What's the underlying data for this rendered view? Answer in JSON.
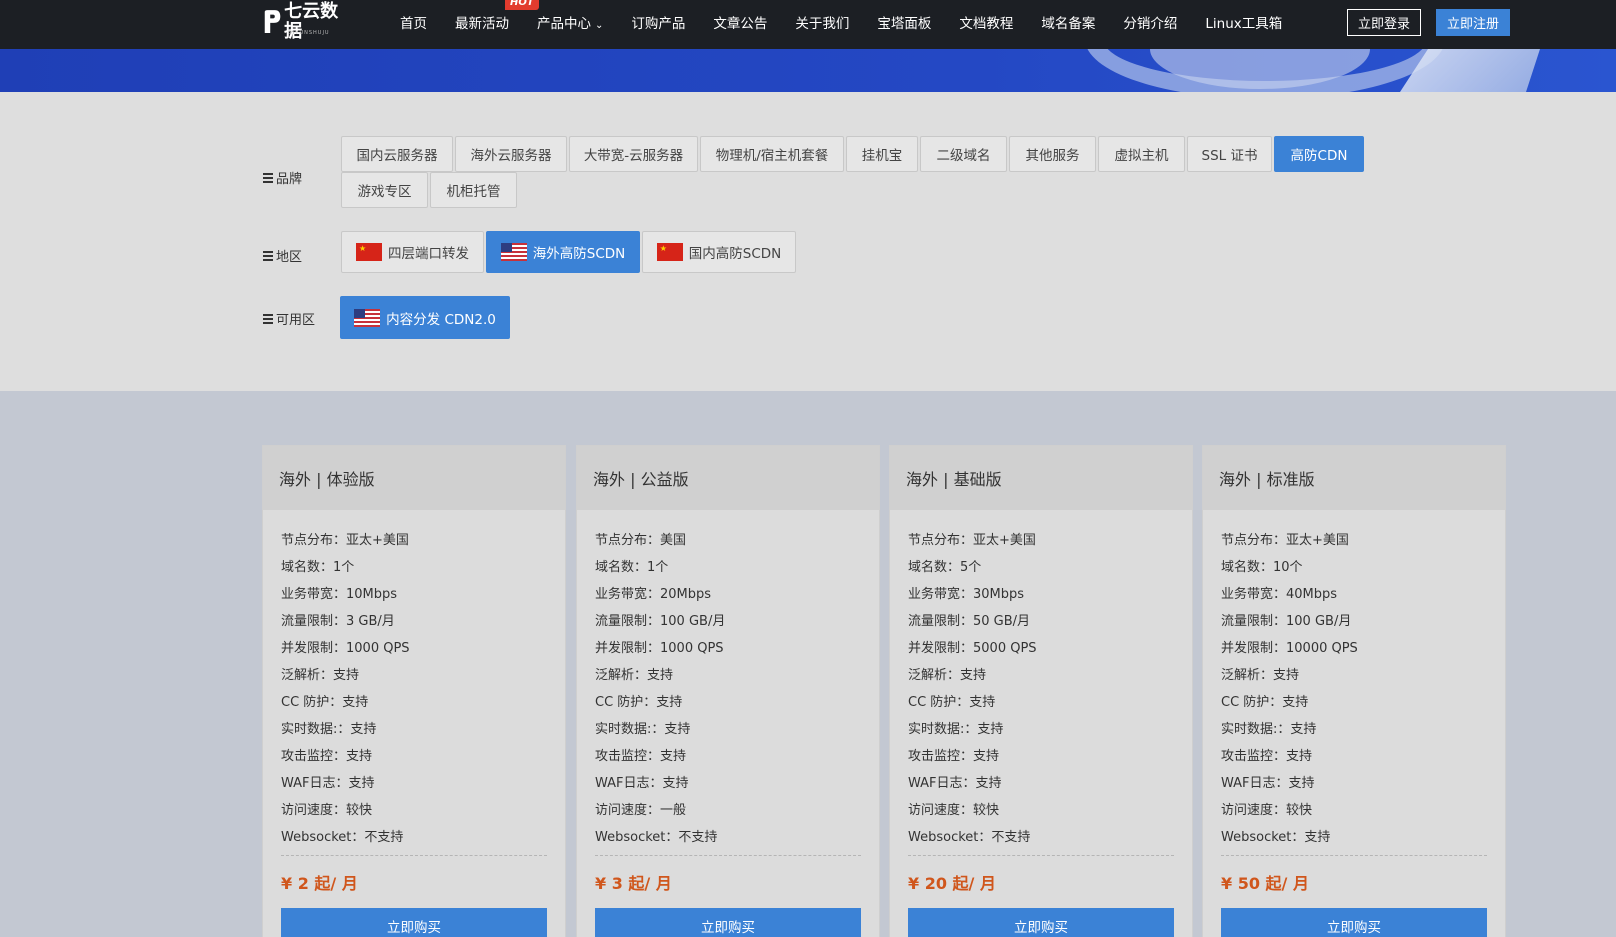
{
  "header": {
    "logo_text": "七云数据",
    "logo_sub": "QIYUNSHUJU",
    "nav": [
      {
        "label": "首页"
      },
      {
        "label": "最新活动",
        "badge": "HOT"
      },
      {
        "label": "产品中心",
        "has_caret": true
      },
      {
        "label": "订购产品"
      },
      {
        "label": "文章公告"
      },
      {
        "label": "关于我们"
      },
      {
        "label": "宝塔面板"
      },
      {
        "label": "文档教程"
      },
      {
        "label": "域名备案"
      },
      {
        "label": "分销介绍"
      },
      {
        "label": "Linux工具箱"
      }
    ],
    "login_label": "立即登录",
    "register_label": "立即注册"
  },
  "filter": {
    "brand_label": "品牌",
    "brands": [
      "国内云服务器",
      "海外云服务器",
      "大带宽-云服务器",
      "物理机/宿主机套餐",
      "挂机宝",
      "二级域名",
      "其他服务",
      "虚拟主机",
      "SSL 证书",
      "高防CDN",
      "游戏专区",
      "机柜托管"
    ],
    "brand_active": "高防CDN",
    "region_label": "地区",
    "regions": [
      {
        "label": "四层端口转发",
        "flag": "cn-flag"
      },
      {
        "label": "海外高防SCDN",
        "flag": "us-flag"
      },
      {
        "label": "国内高防SCDN",
        "flag": "cn-flag"
      }
    ],
    "region_active": "海外高防SCDN",
    "zone_label": "可用区",
    "zones": [
      {
        "label": "内容分发 CDN2.0",
        "flag": "us-flag"
      }
    ]
  },
  "plans": [
    {
      "title": "海外 | 体验版",
      "specs": [
        "节点分布：亚太+美国",
        "域名数：1个",
        "业务带宽：10Mbps",
        "流量限制：3 GB/月",
        "并发限制：1000 QPS",
        "泛解析：支持",
        "CC 防护：支持",
        "实时数据:：支持",
        "攻击监控：支持",
        "WAF日志：支持",
        "访问速度：较快",
        "Websocket：不支持"
      ],
      "price": "¥ 2 起/ 月",
      "buy_label": "立即购买"
    },
    {
      "title": "海外 | 公益版",
      "specs": [
        "节点分布：美国",
        "域名数：1个",
        "业务带宽：20Mbps",
        "流量限制：100 GB/月",
        "并发限制：1000 QPS",
        "泛解析：支持",
        "CC 防护：支持",
        "实时数据:：支持",
        "攻击监控：支持",
        "WAF日志：支持",
        "访问速度：一般",
        "Websocket：不支持"
      ],
      "price": "¥ 3 起/ 月",
      "buy_label": "立即购买"
    },
    {
      "title": "海外 | 基础版",
      "specs": [
        "节点分布：亚太+美国",
        "域名数：5个",
        "业务带宽：30Mbps",
        "流量限制：50 GB/月",
        "并发限制：5000 QPS",
        "泛解析：支持",
        "CC 防护：支持",
        "实时数据:：支持",
        "攻击监控：支持",
        "WAF日志：支持",
        "访问速度：较快",
        "Websocket：不支持"
      ],
      "price": "¥ 20 起/ 月",
      "buy_label": "立即购买"
    },
    {
      "title": "海外 | 标准版",
      "specs": [
        "节点分布：亚太+美国",
        "域名数：10个",
        "业务带宽：40Mbps",
        "流量限制：100 GB/月",
        "并发限制：10000 QPS",
        "泛解析：支持",
        "CC 防护：支持",
        "实时数据:：支持",
        "攻击监控：支持",
        "WAF日志：支持",
        "访问速度：较快",
        "Websocket：支持"
      ],
      "price": "¥ 50 起/ 月",
      "buy_label": "立即购买"
    }
  ],
  "colors": {
    "accent": "#3b82d6",
    "price": "#d0561c",
    "topbar": "#1c1f24",
    "hot_badge": "#e23b2e"
  }
}
